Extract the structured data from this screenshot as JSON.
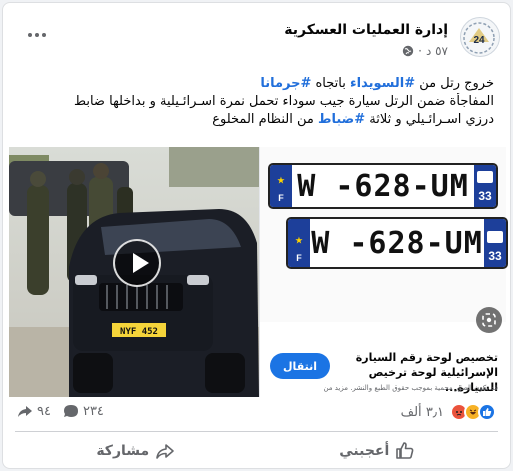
{
  "post": {
    "page_name": "إدارة العمليات العسكرية",
    "time": "٥٧ د",
    "meta_sep": "·",
    "avatar_text": "24",
    "text": {
      "l1_a": "خروج رتل من ",
      "l1_tag1": "#السويداء",
      "l1_b": " باتجاه ",
      "l1_tag2": "#جرمانا",
      "l2": "المفاجأة ضمن الرتل سيارة جيب سوداء تحمل نمرة اسـرائـيلية و بداخلها ضابط",
      "l3_a": "درزي اسـرائـيلي و ثلاثة ",
      "l3_tag": "#ضباط",
      "l3_b": " من النظام المخلوع"
    }
  },
  "video": {
    "car_plate": "NYF 452"
  },
  "ad": {
    "plate_text": "W -628-UM",
    "plate_country": "F",
    "plate_dept": "33",
    "title": "تخصيص لوحة رقم السيارة الإسرائيلية لوحة ترخيص السيارة...",
    "subtitle": "قد تكون الصور محمية بموجب حقوق الطبع والنشر. مزيد من",
    "button_label": "انتقال"
  },
  "stats": {
    "reactions_count": "٣٫١ ألف",
    "comments_count": "٢٣٤",
    "shares_count": "٩٤"
  },
  "actions": {
    "like_label": "أعجبني",
    "share_label": "مشاركة"
  },
  "colors": {
    "accent": "#1b74e4",
    "hashtag": "#216fdb",
    "plate_blue": "#1d3f9a"
  }
}
